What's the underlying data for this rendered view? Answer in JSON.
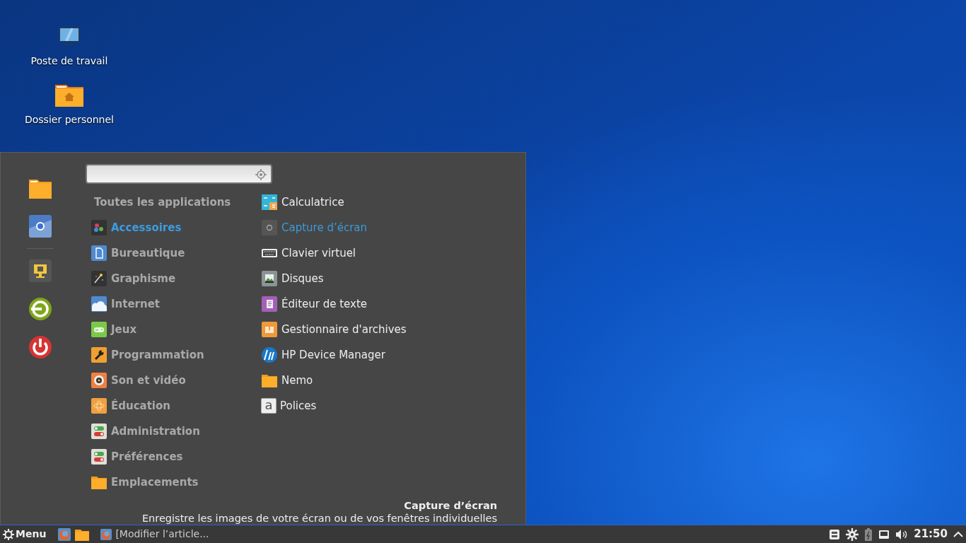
{
  "desktop_icons": [
    {
      "label": "Poste de travail"
    },
    {
      "label": "Dossier personnel"
    }
  ],
  "menu": {
    "all_applications": {
      "label": "Toutes les applications",
      "selected": false
    },
    "categories": [
      {
        "label": "Accessoires",
        "selected": true
      },
      {
        "label": "Bureautique",
        "selected": false
      },
      {
        "label": "Graphisme",
        "selected": false
      },
      {
        "label": "Internet",
        "selected": false
      },
      {
        "label": "Jeux",
        "selected": false
      },
      {
        "label": "Programmation",
        "selected": false
      },
      {
        "label": "Son et vidéo",
        "selected": false
      },
      {
        "label": "Éducation",
        "selected": false
      },
      {
        "label": "Administration",
        "selected": false
      },
      {
        "label": "Préférences",
        "selected": false
      },
      {
        "label": "Emplacements",
        "selected": false
      }
    ],
    "apps": [
      {
        "label": "Calculatrice",
        "selected": false
      },
      {
        "label": "Capture d’écran",
        "selected": true
      },
      {
        "label": "Clavier virtuel",
        "selected": false
      },
      {
        "label": "Disques",
        "selected": false
      },
      {
        "label": "Éditeur de texte",
        "selected": false
      },
      {
        "label": "Gestionnaire d'archives",
        "selected": false
      },
      {
        "label": "HP Device Manager",
        "selected": false
      },
      {
        "label": "Nemo",
        "selected": false
      },
      {
        "label": "Polices",
        "selected": false,
        "icon_text": "a"
      }
    ],
    "description": {
      "title": "Capture d’écran",
      "text": "Enregistre les images de votre écran ou de vos fenêtres individuelles"
    }
  },
  "taskbar": {
    "menu_label": "Menu",
    "windows": [
      {
        "label": "[Modifier l’article..."
      }
    ],
    "clock": "21:50"
  }
}
